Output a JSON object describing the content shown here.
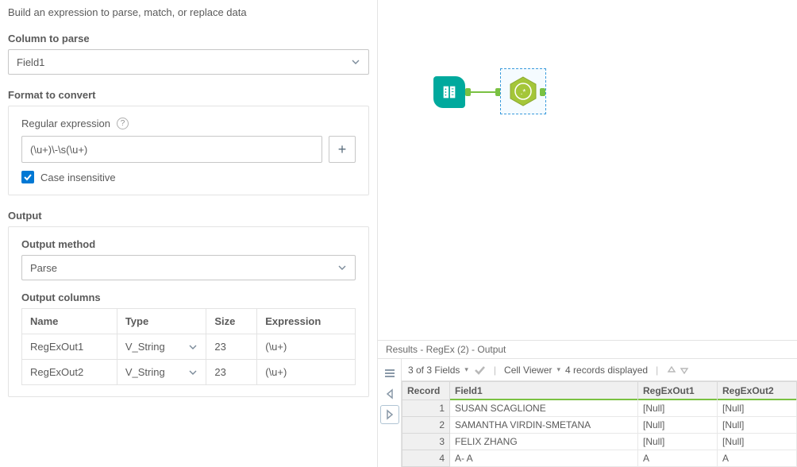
{
  "heading": "Build an expression to parse, match, or replace data",
  "column_to_parse": {
    "label": "Column to parse",
    "value": "Field1"
  },
  "format": {
    "label": "Format to convert",
    "regex_label": "Regular expression",
    "regex_value": "(\\u+)\\-\\s(\\u+)",
    "case_insensitive_label": "Case insensitive"
  },
  "output": {
    "label": "Output",
    "method_label": "Output method",
    "method_value": "Parse",
    "columns_label": "Output columns",
    "headers": {
      "name": "Name",
      "type": "Type",
      "size": "Size",
      "expression": "Expression"
    },
    "rows": [
      {
        "name": "RegExOut1",
        "type": "V_String",
        "size": "23",
        "expression": "(\\u+)"
      },
      {
        "name": "RegExOut2",
        "type": "V_String",
        "size": "23",
        "expression": "(\\u+)"
      }
    ]
  },
  "results": {
    "title": "Results - RegEx (2) - Output",
    "fields_text": "3 of 3 Fields",
    "cell_viewer": "Cell Viewer",
    "records_text": "4 records displayed",
    "headers": {
      "record": "Record",
      "field1": "Field1",
      "out1": "RegExOut1",
      "out2": "RegExOut2"
    },
    "rows": [
      {
        "r": "1",
        "f1": "SUSAN SCAGLIONE",
        "o1": "[Null]",
        "o2": "[Null]"
      },
      {
        "r": "2",
        "f1": "SAMANTHA VIRDIN-SMETANA",
        "o1": "[Null]",
        "o2": "[Null]"
      },
      {
        "r": "3",
        "f1": "FELIX ZHANG",
        "o1": "[Null]",
        "o2": "[Null]"
      },
      {
        "r": "4",
        "f1": "A- A",
        "o1": "A",
        "o2": "A"
      }
    ]
  }
}
